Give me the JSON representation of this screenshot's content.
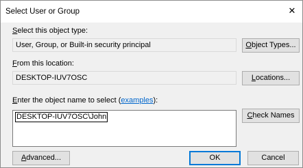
{
  "window": {
    "title": "Select User or Group",
    "close_glyph": "✕"
  },
  "object_type": {
    "label_prefix": "",
    "label_accel": "S",
    "label_rest": "elect this object type:",
    "value": "User, Group, or Built-in security principal",
    "button_accel_pre": "",
    "button_accel": "O",
    "button_rest": "bject Types..."
  },
  "location": {
    "label_accel": "F",
    "label_rest": "rom this location:",
    "value": "DESKTOP-IUV7OSC",
    "button_accel": "L",
    "button_rest": "ocations..."
  },
  "object_name": {
    "label_accel": "E",
    "label_rest": "nter the object name to select (",
    "link_text": "examples",
    "label_end": "):",
    "value": "DESKTOP-IUV7OSC\\John",
    "check_accel": "C",
    "check_rest": "heck Names"
  },
  "footer": {
    "advanced_accel": "A",
    "advanced_rest": "dvanced...",
    "ok_label": "OK",
    "cancel_label": "Cancel"
  }
}
